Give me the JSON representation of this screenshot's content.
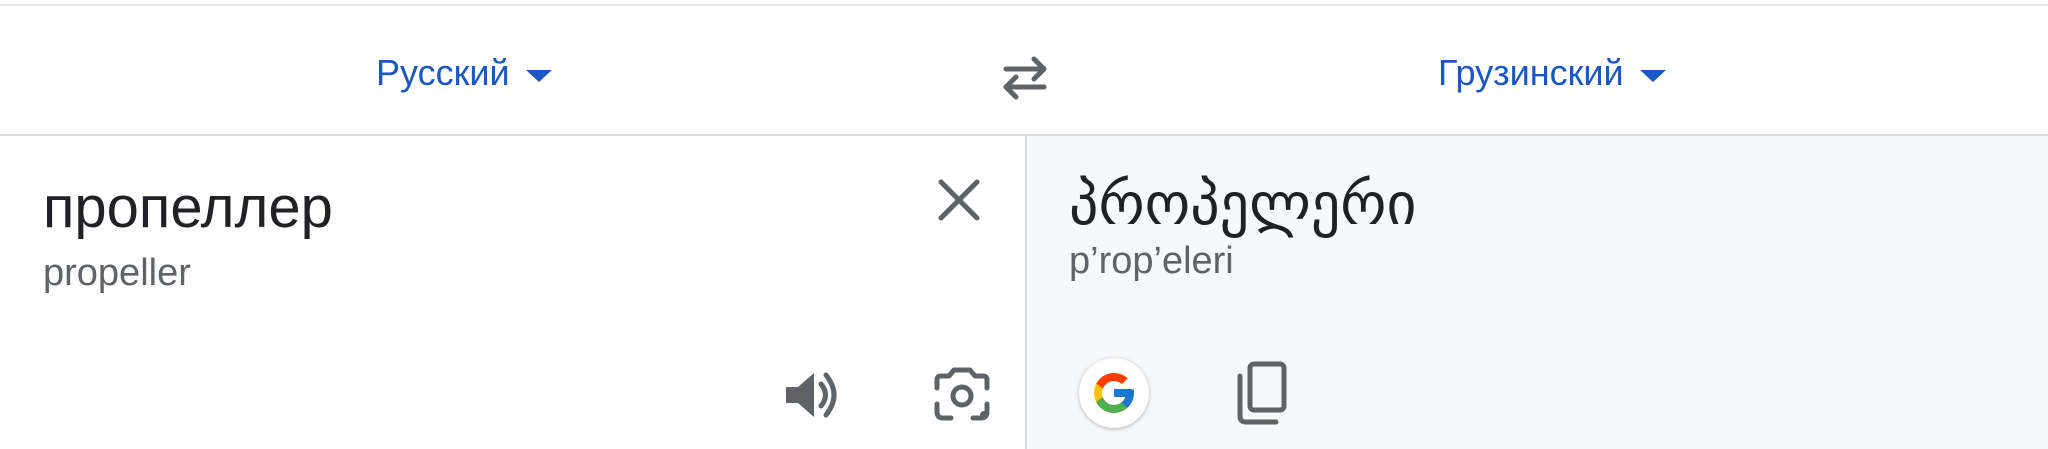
{
  "lang_bar": {
    "source_language": "Русский",
    "target_language": "Грузинский"
  },
  "source": {
    "text": "пропеллер",
    "transliteration": "propeller"
  },
  "target": {
    "text": "პროპელერი",
    "transliteration": "p’rop’eleri"
  },
  "icons": {
    "swap": "swap-arrows-icon",
    "clear": "close-icon",
    "speaker": "speaker-icon",
    "camera": "camera-icon",
    "google": "google-g-icon",
    "copy": "copy-icon"
  },
  "colors": {
    "accent": "#1a56c4",
    "icon_gray": "#5f6368",
    "target_panel_bg": "#f7f8fa"
  }
}
